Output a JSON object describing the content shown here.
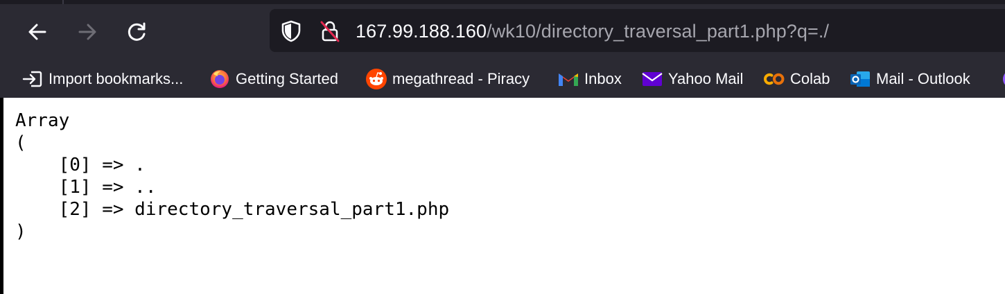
{
  "browser": {
    "nav": {
      "back_icon": "arrow-left-icon",
      "forward_icon": "arrow-right-icon",
      "reload_icon": "reload-icon"
    },
    "url": {
      "host": "167.99.188.160",
      "path": "/wk10/directory_traversal_part1.php?q=./"
    },
    "bookmarks": [
      {
        "label": "Import bookmarks...",
        "icon": "import-icon"
      },
      {
        "label": "Getting Started",
        "icon": "firefox-icon"
      },
      {
        "label": "megathread - Piracy",
        "icon": "reddit-icon"
      },
      {
        "label": "Inbox",
        "icon": "gmail-icon"
      },
      {
        "label": "Yahoo Mail",
        "icon": "yahoo-mail-icon"
      },
      {
        "label": "Colab",
        "icon": "colab-icon"
      },
      {
        "label": "Mail - Outlook",
        "icon": "outlook-icon"
      }
    ],
    "colors": {
      "toolbar_bg": "#2b2a33",
      "urlbar_bg": "#1c1b22",
      "text": "#fbfbfe",
      "url_path": "#a6a6ae"
    }
  },
  "page": {
    "output_lines": [
      "Array",
      "(",
      "    [0] => .",
      "    [1] => ..",
      "    [2] => directory_traversal_part1.php",
      ")"
    ]
  }
}
